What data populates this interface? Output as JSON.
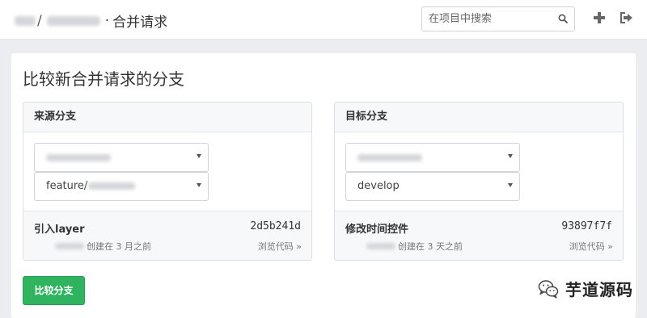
{
  "header": {
    "breadcrumb_separator": "/",
    "breadcrumb_dot": "·",
    "page_name": "合并请求",
    "search_placeholder": "在项目中搜索",
    "icons": {
      "search": "search-icon",
      "add": "plus-icon",
      "sign_out": "sign-out-icon"
    }
  },
  "main": {
    "title": "比较新合并请求的分支",
    "source": {
      "heading": "来源分支",
      "branch_prefix": "feature/",
      "commit_message": "引入layer",
      "commit_hash": "2d5b241d",
      "created": "创建在 3 月之前",
      "browse": "浏览代码 »"
    },
    "target": {
      "heading": "目标分支",
      "branch": "develop",
      "commit_message": "修改时间控件",
      "commit_hash": "93897f7f",
      "created": "创建在 3 天之前",
      "browse": "浏览代码 »"
    },
    "compare_button": "比较分支"
  },
  "watermark": {
    "text": "芋道源码",
    "icon": "wechat-icon"
  },
  "colors": {
    "accent_green": "#2fb35f",
    "background": "#ebedf0"
  }
}
